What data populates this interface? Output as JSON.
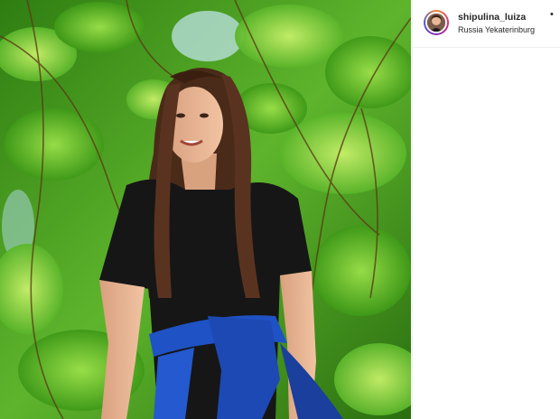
{
  "post": {
    "username": "shipulina_luiza",
    "separator": "•",
    "location": "Russia Yekaterinburg"
  },
  "icons": {
    "avatar": "profile-avatar-icon"
  },
  "colors": {
    "foliage": "#3e8f1a",
    "shirt": "#161616",
    "jacket": "#1f52c4",
    "hair": "#4a2a18",
    "text": "#262626"
  }
}
